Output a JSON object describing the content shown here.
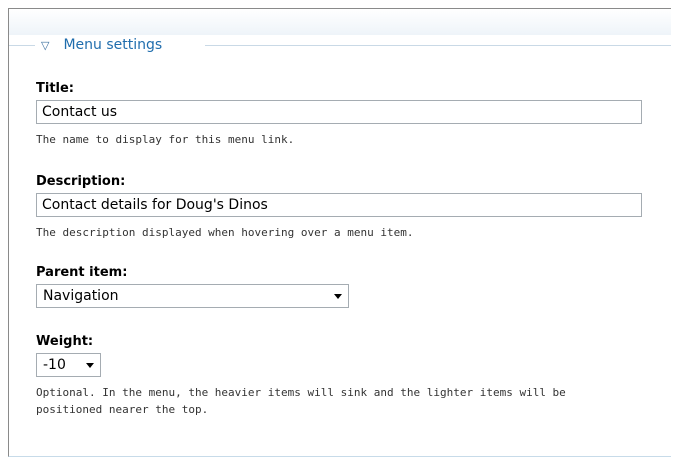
{
  "fieldset": {
    "legend": "Menu settings",
    "toggle_icon": "triangle-down-icon"
  },
  "title_field": {
    "label": "Title:",
    "value": "Contact us",
    "description": "The name to display for this menu link."
  },
  "description_field": {
    "label": "Description:",
    "value": "Contact details for Doug's Dinos",
    "description": "The description displayed when hovering over a menu item."
  },
  "parent_field": {
    "label": "Parent item:",
    "selected": "Navigation"
  },
  "weight_field": {
    "label": "Weight:",
    "selected": "-10",
    "description_line1": "Optional. In the menu, the heavier items will sink and the lighter items will be",
    "description_line2": "positioned nearer the top."
  },
  "colors": {
    "legend_link": "#1f6dad",
    "field_border": "#a5acb2"
  }
}
